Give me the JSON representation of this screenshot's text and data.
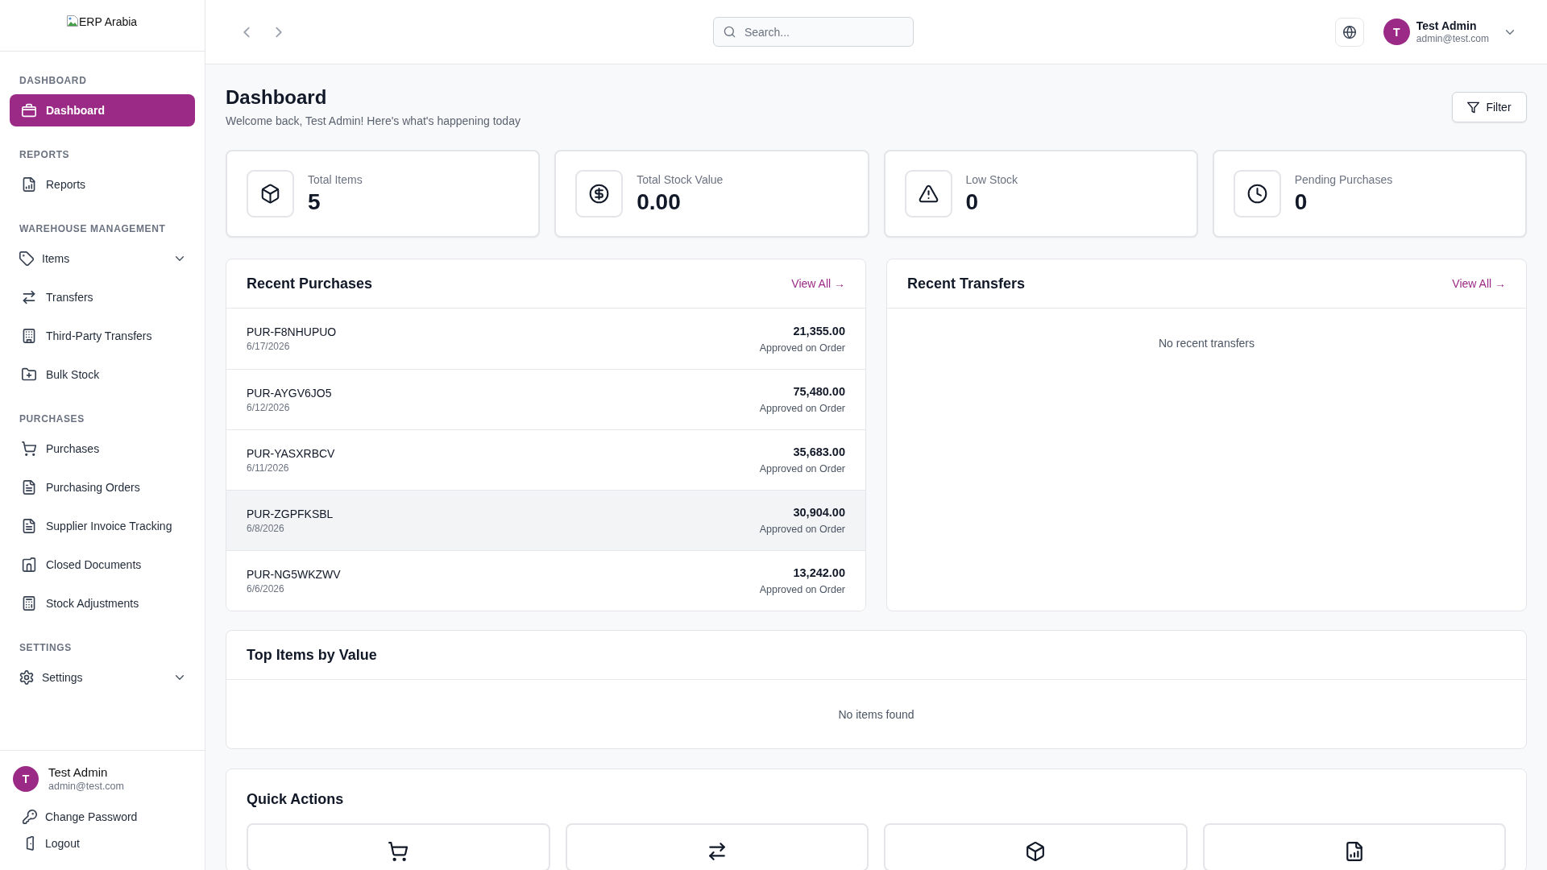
{
  "sidebar": {
    "logo": {
      "alt_text": "ERP Arabia"
    },
    "sections": [
      {
        "heading": "DASHBOARD",
        "items": [
          {
            "label": "Dashboard",
            "kind": "link",
            "selected": true
          }
        ]
      },
      {
        "heading": "REPORTS",
        "items": [
          {
            "label": "Reports",
            "kind": "link",
            "selected": false
          }
        ]
      },
      {
        "heading": "WAREHOUSE MANAGEMENT",
        "items": [
          {
            "label": "Items",
            "kind": "group",
            "expanded": false,
            "selected": false
          },
          {
            "label": "Transfers",
            "kind": "link",
            "selected": false
          },
          {
            "label": "Third-Party Transfers",
            "kind": "link",
            "selected": false
          },
          {
            "label": "Bulk Stock",
            "kind": "link",
            "selected": false
          }
        ]
      },
      {
        "heading": "PURCHASES",
        "items": [
          {
            "label": "Purchases",
            "kind": "link",
            "selected": false
          },
          {
            "label": "Purchasing Orders",
            "kind": "link",
            "selected": false
          },
          {
            "label": "Supplier Invoice Tracking",
            "kind": "link",
            "selected": false
          },
          {
            "label": "Closed Documents",
            "kind": "link",
            "selected": false
          },
          {
            "label": "Stock Adjustments",
            "kind": "link",
            "selected": false
          }
        ]
      },
      {
        "heading": "SETTINGS",
        "items": [
          {
            "label": "Settings",
            "kind": "group",
            "expanded": false,
            "selected": false
          }
        ]
      }
    ],
    "user": {
      "avatar_initial": "T",
      "name": "Test Admin",
      "email": "admin@test.com"
    },
    "account_links": [
      {
        "label": "Change Password"
      },
      {
        "label": "Logout"
      }
    ]
  },
  "top_bar": {
    "search": {
      "placeholder": "Search..."
    },
    "user": {
      "avatar_initial": "T",
      "name": "Test Admin",
      "email": "admin@test.com"
    }
  },
  "page_header": {
    "title": "Dashboard",
    "subtitle": "Welcome back, Test Admin! Here's what's happening today",
    "filter_button": "Filter"
  },
  "stats": [
    {
      "label": "Total Items",
      "value": "5"
    },
    {
      "label": "Total Stock Value",
      "value": "0.00"
    },
    {
      "label": "Low Stock",
      "value": "0"
    },
    {
      "label": "Pending Purchases",
      "value": "0"
    }
  ],
  "recent_purchases": {
    "title": "Recent Purchases",
    "view_all": "View All →",
    "rows": [
      {
        "id": "PUR-F8NHUPUO",
        "date": "6/17/2026",
        "amount": "21,355.00",
        "status": "Approved on Order",
        "hovered": false
      },
      {
        "id": "PUR-AYGV6JO5",
        "date": "6/12/2026",
        "amount": "75,480.00",
        "status": "Approved on Order",
        "hovered": false
      },
      {
        "id": "PUR-YASXRBCV",
        "date": "6/11/2026",
        "amount": "35,683.00",
        "status": "Approved on Order",
        "hovered": false
      },
      {
        "id": "PUR-ZGPFKSBL",
        "date": "6/8/2026",
        "amount": "30,904.00",
        "status": "Approved on Order",
        "hovered": true
      },
      {
        "id": "PUR-NG5WKZWV",
        "date": "6/6/2026",
        "amount": "13,242.00",
        "status": "Approved on Order",
        "hovered": false
      }
    ]
  },
  "recent_transfers": {
    "title": "Recent Transfers",
    "view_all": "View All →",
    "empty_message": "No recent transfers"
  },
  "top_items": {
    "title": "Top Items by Value",
    "empty_message": "No items found"
  },
  "quick_actions": {
    "title": "Quick Actions"
  }
}
